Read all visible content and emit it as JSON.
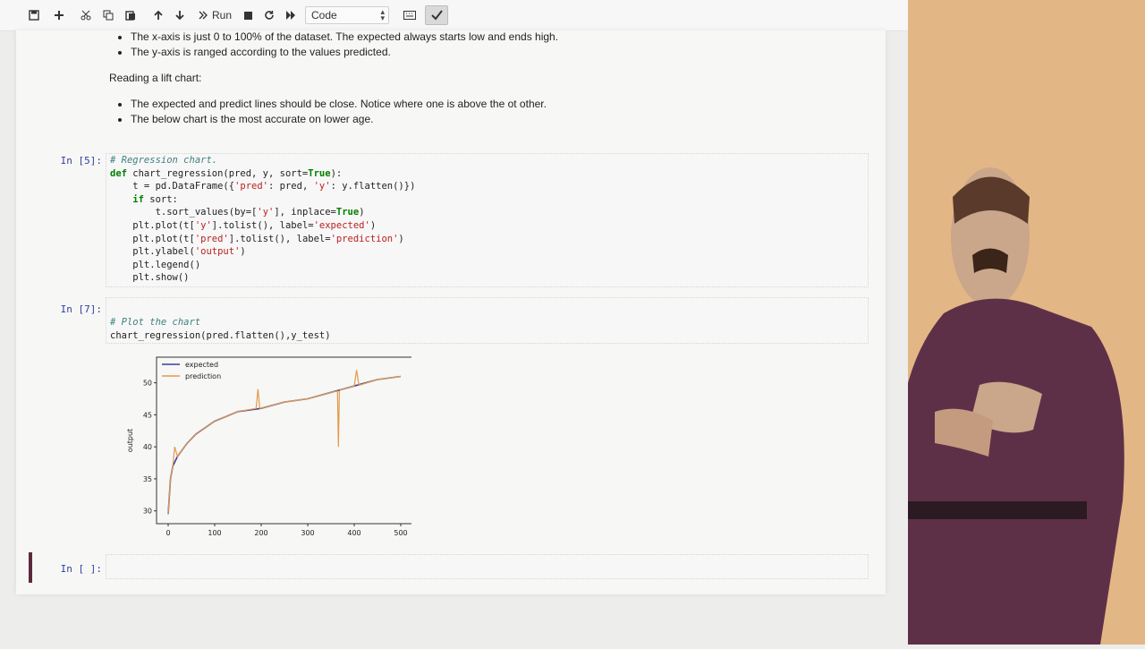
{
  "toolbar": {
    "save_icon": "save-icon",
    "run_label": "Run",
    "cell_type": "Code",
    "colors": {
      "background": "#f7f7f7",
      "prompt": "#303f9f"
    }
  },
  "markdown": {
    "bullets_top": [
      "The x-axis is just 0 to 100% of the dataset. The expected always starts low and ends high.",
      "The y-axis is ranged according to the values predicted."
    ],
    "heading": "Reading a lift chart:",
    "bullets_bottom": [
      "The expected and predict lines should be close. Notice where one is above the ot other.",
      "The below chart is the most accurate on lower age."
    ]
  },
  "cells": [
    {
      "prompt": "In [5]:",
      "lines": [
        "# Regression chart.",
        "def chart_regression(pred, y, sort=True):",
        "    t = pd.DataFrame({'pred': pred, 'y': y.flatten()})",
        "    if sort:",
        "        t.sort_values(by=['y'], inplace=True)",
        "    plt.plot(t['y'].tolist(), label='expected')",
        "    plt.plot(t['pred'].tolist(), label='prediction')",
        "    plt.ylabel('output')",
        "    plt.legend()",
        "    plt.show()"
      ]
    },
    {
      "prompt": "In [7]:",
      "lines": [
        "# Plot the chart",
        "chart_regression(pred.flatten(),y_test)"
      ]
    },
    {
      "prompt": "In [ ]:",
      "lines": [
        ""
      ]
    }
  ],
  "chart_data": {
    "type": "line",
    "ylabel": "output",
    "xlim": [
      -25,
      525
    ],
    "ylim": [
      28,
      54
    ],
    "xticks": [
      0,
      100,
      200,
      300,
      400,
      500
    ],
    "yticks": [
      30,
      35,
      40,
      45,
      50
    ],
    "legend_position": "top-left",
    "series": [
      {
        "name": "expected",
        "color": "#3b3f9e",
        "x": [
          0,
          5,
          10,
          20,
          40,
          60,
          80,
          100,
          150,
          200,
          250,
          300,
          350,
          400,
          450,
          500
        ],
        "y": [
          29.5,
          35,
          37,
          38.5,
          40.5,
          42,
          43,
          44,
          45.5,
          46,
          47,
          47.5,
          48.5,
          49.5,
          50.5,
          51
        ]
      },
      {
        "name": "prediction",
        "color": "#e29a4a",
        "x": [
          0,
          5,
          10,
          14,
          20,
          40,
          60,
          80,
          100,
          150,
          189,
          193,
          197,
          200,
          250,
          300,
          350,
          364,
          366,
          368,
          370,
          400,
          405,
          410,
          450,
          500
        ],
        "y": [
          29.5,
          35,
          37,
          40,
          38.5,
          40.5,
          42,
          43,
          44,
          45.5,
          46,
          49,
          46,
          46,
          47,
          47.5,
          48.5,
          48.7,
          40,
          48.7,
          48.9,
          49.5,
          52,
          49.6,
          50.5,
          51
        ]
      }
    ]
  }
}
